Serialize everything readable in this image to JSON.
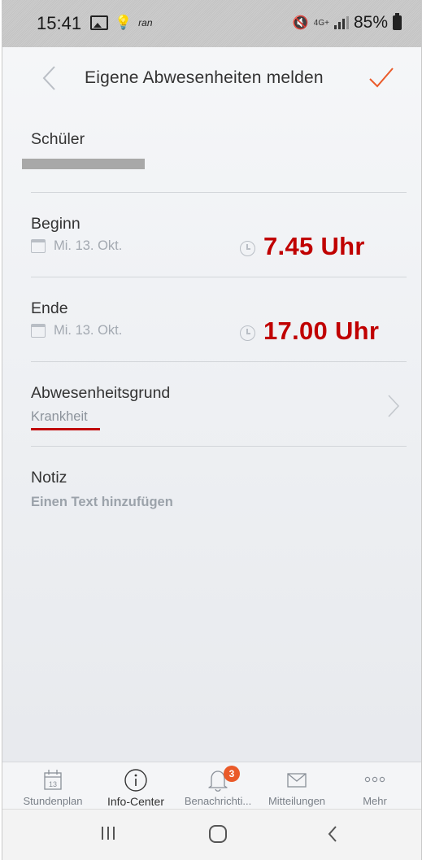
{
  "status_bar": {
    "time": "15:41",
    "carrier": "ran",
    "network": "4G+",
    "battery": "85%"
  },
  "header": {
    "title": "Eigene Abwesenheiten melden"
  },
  "student": {
    "label": "Schüler"
  },
  "begin": {
    "label": "Beginn",
    "date": "Mi. 13. Okt.",
    "time": "7.45 Uhr"
  },
  "end": {
    "label": "Ende",
    "date": "Mi. 13. Okt.",
    "time": "17.00 Uhr"
  },
  "reason": {
    "label": "Abwesenheitsgrund",
    "value": "Krankheit"
  },
  "note": {
    "label": "Notiz",
    "action": "Einen Text hinzufügen"
  },
  "bottom_nav": {
    "items": [
      {
        "label": "Stundenplan",
        "icon": "calendar-icon",
        "icon_text": "13"
      },
      {
        "label": "Info-Center",
        "icon": "info-icon",
        "active": true
      },
      {
        "label": "Benachrichti...",
        "icon": "bell-icon",
        "badge": "3"
      },
      {
        "label": "Mitteilungen",
        "icon": "mail-icon"
      },
      {
        "label": "Mehr",
        "icon": "more-icon"
      }
    ]
  },
  "colors": {
    "accent": "#ea5a29",
    "annotation_red": "#c00000"
  }
}
